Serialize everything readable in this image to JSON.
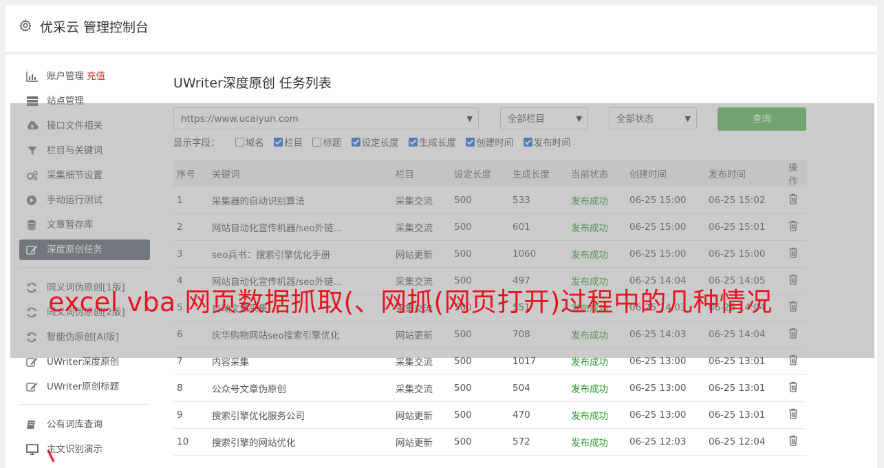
{
  "header": {
    "title": "优采云 管理控制台",
    "icon": "gear-icon"
  },
  "sidebar": {
    "group1": [
      {
        "label": "账户管理",
        "extra": "充值",
        "icon": "bar-chart-icon"
      },
      {
        "label": "站点管理",
        "icon": "server-icon"
      },
      {
        "label": "接口文件相关",
        "icon": "cloud-upload-icon"
      },
      {
        "label": "栏目与关键词",
        "icon": "filter-icon"
      },
      {
        "label": "采集细节设置",
        "icon": "cogs-icon"
      },
      {
        "label": "手动运行测试",
        "icon": "play-circle-icon"
      },
      {
        "label": "文章暂存库",
        "icon": "database-icon"
      },
      {
        "label": "深度原创任务",
        "icon": "edit-icon",
        "active": true
      }
    ],
    "group2": [
      {
        "label": "同义词伪原创[1版]",
        "icon": "refresh-icon"
      },
      {
        "label": "同义词伪原创[2版]",
        "icon": "refresh-icon"
      },
      {
        "label": "智能伪原创[AI版]",
        "icon": "refresh-icon"
      },
      {
        "label": "UWriter深度原创",
        "icon": "edit-icon"
      },
      {
        "label": "UWriter原创标题",
        "icon": "edit-icon"
      }
    ],
    "group3": [
      {
        "label": "公有词库查询",
        "icon": "book-icon"
      },
      {
        "label": "主文识别演示",
        "icon": "monitor-icon"
      }
    ]
  },
  "main": {
    "title": "UWriter深度原创 任务列表",
    "filters": {
      "site": "https://www.ucaiyun.com",
      "column": "全部栏目",
      "status": "全部状态",
      "query_label": "查询"
    },
    "fields": {
      "label": "显示字段：",
      "items": [
        {
          "label": "域名",
          "checked": false
        },
        {
          "label": "栏目",
          "checked": true
        },
        {
          "label": "标题",
          "checked": false
        },
        {
          "label": "设定长度",
          "checked": true
        },
        {
          "label": "生成长度",
          "checked": true
        },
        {
          "label": "创建时间",
          "checked": true
        },
        {
          "label": "发布时间",
          "checked": true
        }
      ]
    },
    "table": {
      "headers": [
        "序号",
        "关键词",
        "栏目",
        "设定长度",
        "生成长度",
        "当前状态",
        "创建时间",
        "发布时间",
        "操作"
      ],
      "rows": [
        [
          "1",
          "采集器的自动识别算法",
          "采集交流",
          "500",
          "533",
          "发布成功",
          "06-25 15:00",
          "06-25 15:02"
        ],
        [
          "2",
          "网站自动化宣传机器/seo外链...",
          "采集交流",
          "500",
          "601",
          "发布成功",
          "06-25 15:00",
          "06-25 15:01"
        ],
        [
          "3",
          "seo兵书：搜索引擎优化手册",
          "网站更新",
          "500",
          "1060",
          "发布成功",
          "06-25 15:00",
          "06-25 15:00"
        ],
        [
          "4",
          "网站自动化宣传机器/seo外链...",
          "采集交流",
          "500",
          "497",
          "发布成功",
          "06-25 14:04",
          "06-25 14:05"
        ],
        [
          "5",
          "自动文章采集",
          "采集交流",
          "500",
          "551",
          "发布成功",
          "06-25 14:03",
          "06-25 14:04"
        ],
        [
          "6",
          "庆华购物网站seo搜索引擎优化",
          "网站更新",
          "500",
          "708",
          "发布成功",
          "06-25 14:03",
          "06-25 14:04"
        ],
        [
          "7",
          "内容采集",
          "采集交流",
          "500",
          "1017",
          "发布成功",
          "06-25 13:00",
          "06-25 13:01"
        ],
        [
          "8",
          "公众号文章伪原创",
          "采集交流",
          "500",
          "504",
          "发布成功",
          "06-25 13:00",
          "06-25 13:01"
        ],
        [
          "9",
          "搜索引擎优化服务公司",
          "网站更新",
          "500",
          "470",
          "发布成功",
          "06-25 13:00",
          "06-25 13:01"
        ],
        [
          "10",
          "搜索引擎的网站优化",
          "网站更新",
          "500",
          "572",
          "发布成功",
          "06-25 12:03",
          "06-25 12:04"
        ]
      ]
    }
  },
  "overlay": {
    "headline": "excel vba 网页数据抓取(、网抓(网页打开)过程中的几种情况"
  },
  "colors": {
    "accent_green": "#5cb85c",
    "status_green": "#2e9a2e",
    "active_bg": "#5f6470",
    "headline_red": "#e8141e"
  }
}
